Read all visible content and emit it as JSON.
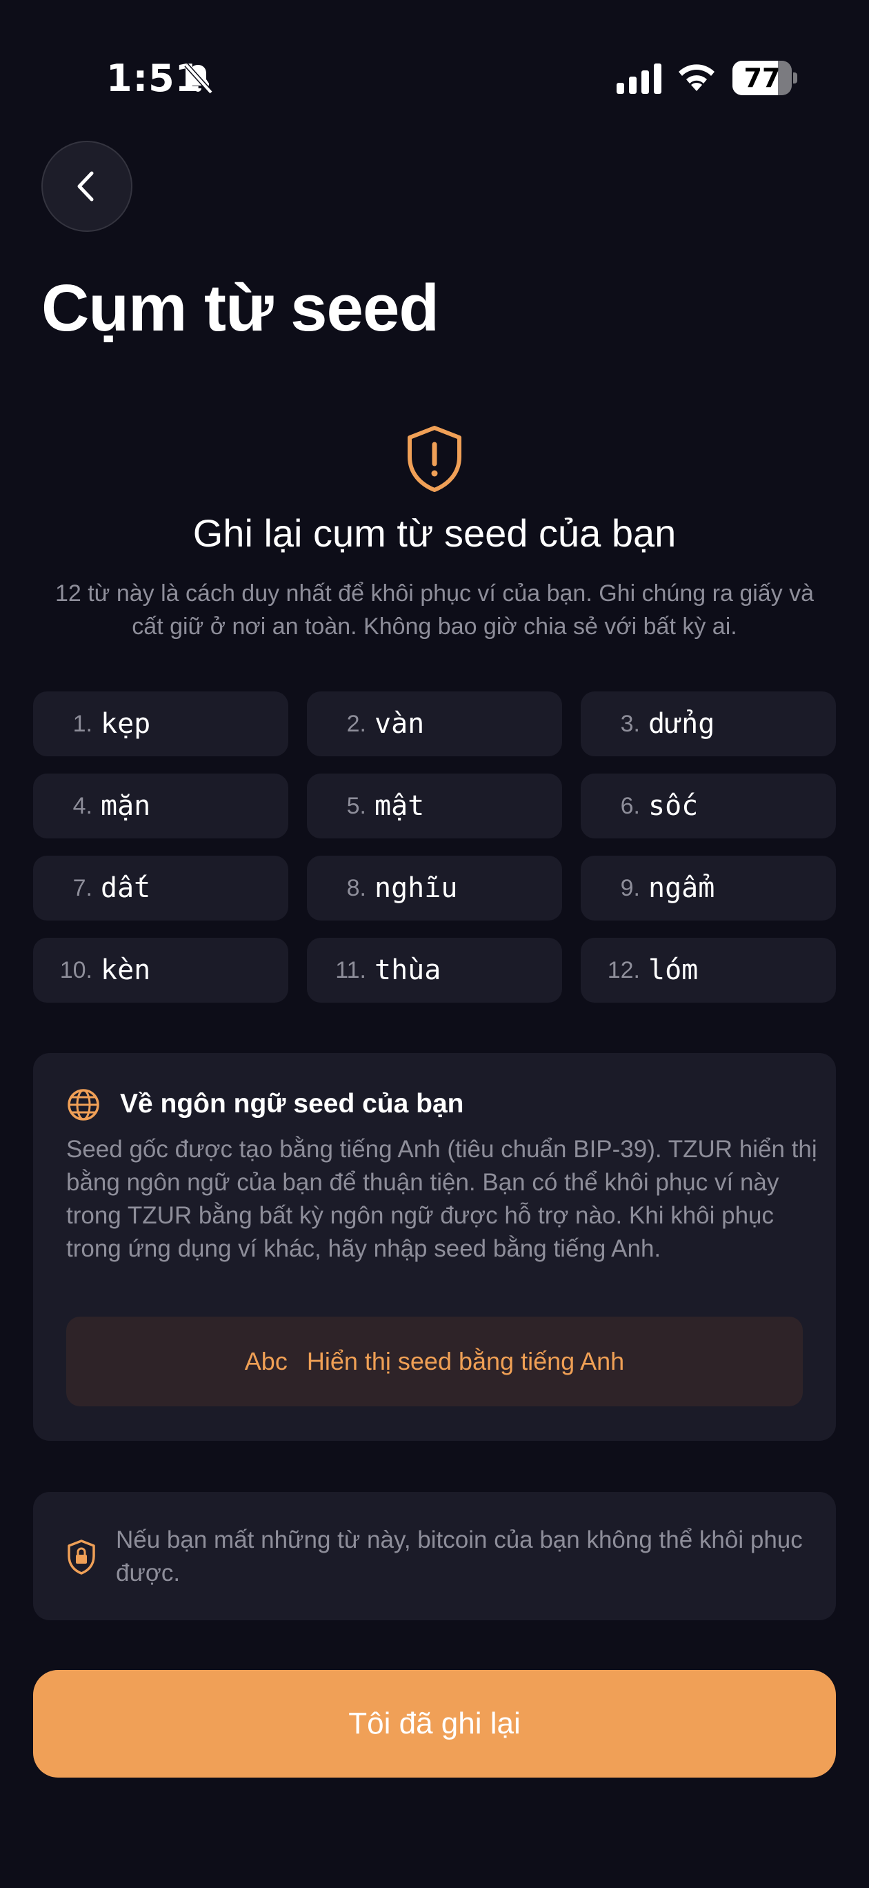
{
  "status_bar": {
    "time": "1:51",
    "battery_level": "77",
    "battery_fraction": 0.77
  },
  "header": {
    "title": "Cụm từ seed"
  },
  "intro": {
    "heading": "Ghi lại cụm từ seed của bạn",
    "description": "12 từ này là cách duy nhất để khôi phục ví của bạn. Ghi chúng ra giấy và cất giữ ở nơi an toàn. Không bao giờ chia sẻ với bất kỳ ai."
  },
  "seed_words": [
    {
      "num": "1.",
      "word": "kẹp"
    },
    {
      "num": "2.",
      "word": "vàn"
    },
    {
      "num": "3.",
      "word": "dửng"
    },
    {
      "num": "4.",
      "word": "mặn"
    },
    {
      "num": "5.",
      "word": "mật"
    },
    {
      "num": "6.",
      "word": "sốc"
    },
    {
      "num": "7.",
      "word": "dất"
    },
    {
      "num": "8.",
      "word": "nghĩu"
    },
    {
      "num": "9.",
      "word": "ngẩm"
    },
    {
      "num": "10.",
      "word": "kèn"
    },
    {
      "num": "11.",
      "word": "thùa"
    },
    {
      "num": "12.",
      "word": "lóm"
    }
  ],
  "language_card": {
    "title": "Về ngôn ngữ seed của bạn",
    "description": "Seed gốc được tạo bằng tiếng Anh (tiêu chuẩn BIP-39). TZUR hiển thị bằng ngôn ngữ của bạn để thuận tiện. Bạn có thể khôi phục ví này trong TZUR bằng bất kỳ ngôn ngữ được hỗ trợ nào. Khi khôi phục trong ứng dụng ví khác, hãy nhập seed bằng tiếng Anh.",
    "button_icon_text": "Abc",
    "button_label": "Hiển thị seed bằng tiếng Anh"
  },
  "note": {
    "text": "Nếu bạn mất những từ này, bitcoin của bạn không thể khôi phục được."
  },
  "confirm_button": {
    "label": "Tôi đã ghi lại"
  },
  "colors": {
    "background": "#0d0d18",
    "card": "#1b1b28",
    "accent": "#f0a057",
    "muted_text": "#8e8e9a"
  }
}
